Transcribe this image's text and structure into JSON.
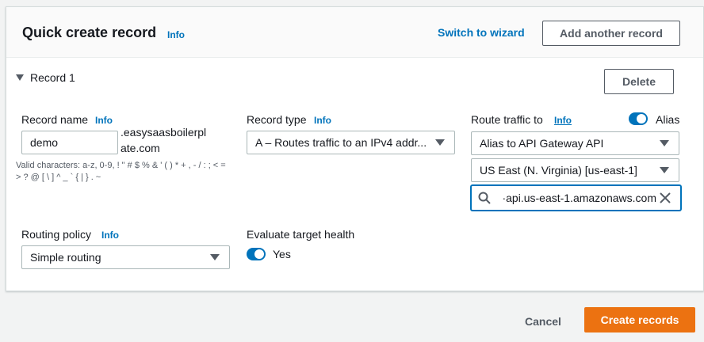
{
  "header": {
    "title": "Quick create record",
    "info": "Info",
    "switch_wizard": "Switch to wizard",
    "add_record": "Add another record"
  },
  "record": {
    "toggle_label": "Record 1",
    "delete": "Delete",
    "record_name": {
      "label": "Record name",
      "info": "Info",
      "value": "demo",
      "domain_suffix": ".easysaasboilerplate.com",
      "hint": "Valid characters: a-z, 0-9, ! \" # $ % & ' ( ) * + , - / : ; < = > ? @ [ \\ ] ^ _ ` { | } . ~"
    },
    "record_type": {
      "label": "Record type",
      "info": "Info",
      "value": "A – Routes traffic to an IPv4 addr..."
    },
    "route_traffic": {
      "label": "Route traffic to",
      "info": "Info",
      "alias_label": "Alias",
      "alias_enabled": true,
      "endpoint_type": "Alias to API Gateway API",
      "region": "US East (N. Virginia) [us-east-1]",
      "search_value": "·api.us-east-1.amazonaws.com"
    },
    "routing_policy": {
      "label": "Routing policy",
      "info": "Info",
      "value": "Simple routing"
    },
    "evaluate_health": {
      "label": "Evaluate target health",
      "toggle_label": "Yes",
      "enabled": true
    }
  },
  "footer": {
    "cancel": "Cancel",
    "create": "Create records"
  },
  "colors": {
    "link": "#0073bb",
    "primary": "#ec7211",
    "toggle_on": "#0073bb"
  }
}
